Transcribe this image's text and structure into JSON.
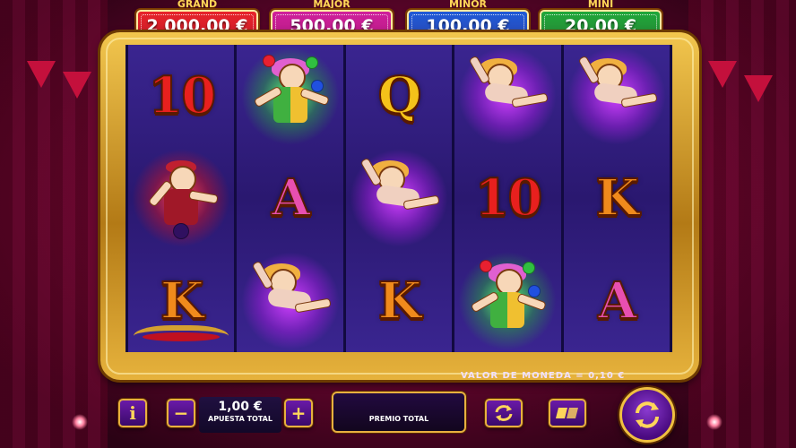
{
  "jackpots": [
    {
      "label": "GRAND",
      "value": "2 000,00 €",
      "color": "#e8232a"
    },
    {
      "label": "MAJOR",
      "value": "500,00 €",
      "color": "#d0209c"
    },
    {
      "label": "MINOR",
      "value": "100,00 €",
      "color": "#1f5ad8"
    },
    {
      "label": "MINI",
      "value": "20,00 €",
      "color": "#1fa83a"
    }
  ],
  "reels": [
    [
      "10",
      "mechanic",
      "K"
    ],
    [
      "clown",
      "A",
      "acrobat"
    ],
    [
      "Q",
      "acrobat",
      "K"
    ],
    [
      "acrobat",
      "10",
      "clown"
    ],
    [
      "acrobat",
      "K",
      "A"
    ]
  ],
  "coin_value": "VALOR DE MONEDA = 0,10 €",
  "controls": {
    "info_icon": "i",
    "bet_value": "1,00 €",
    "bet_label": "APUESTA TOTAL",
    "minus": "−",
    "plus": "+",
    "win_label": "PREMIO TOTAL"
  },
  "colors": {
    "background": "#6a0530",
    "frame_gold": "#d9a53a",
    "reel_bg": "#2a1870",
    "button_purple": "#4a0f88"
  }
}
